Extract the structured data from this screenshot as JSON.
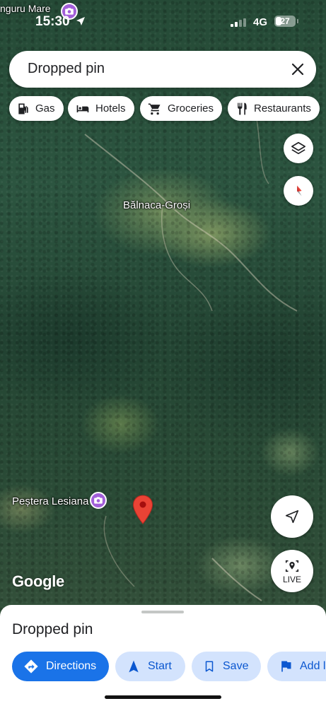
{
  "status_bar": {
    "time": "15:30",
    "network": "4G",
    "battery": "27"
  },
  "map": {
    "top_place_label": "nguru Mare",
    "village_label": "Bălnaca-Groși",
    "poi_label": "Peștera Lesiana",
    "attribution": "Google"
  },
  "search": {
    "value": "Dropped pin",
    "close_icon": "close-icon"
  },
  "chips": [
    {
      "label": "Gas",
      "icon": "gas-station-icon"
    },
    {
      "label": "Hotels",
      "icon": "hotel-bed-icon"
    },
    {
      "label": "Groceries",
      "icon": "shopping-cart-icon"
    },
    {
      "label": "Restaurants",
      "icon": "fork-knife-icon"
    }
  ],
  "controls": {
    "layers_icon": "layers-icon",
    "compass_icon": "compass-icon",
    "my_location_icon": "navigation-arrow-icon",
    "live_label": "LIVE"
  },
  "sheet": {
    "title": "Dropped pin",
    "actions": {
      "directions": "Directions",
      "start": "Start",
      "save": "Save",
      "add": "Add l"
    }
  },
  "colors": {
    "accent": "#1a73e8",
    "chip_tint": "#d3e3fd",
    "pin": "#ea4335",
    "poi": "#a25fd9"
  }
}
